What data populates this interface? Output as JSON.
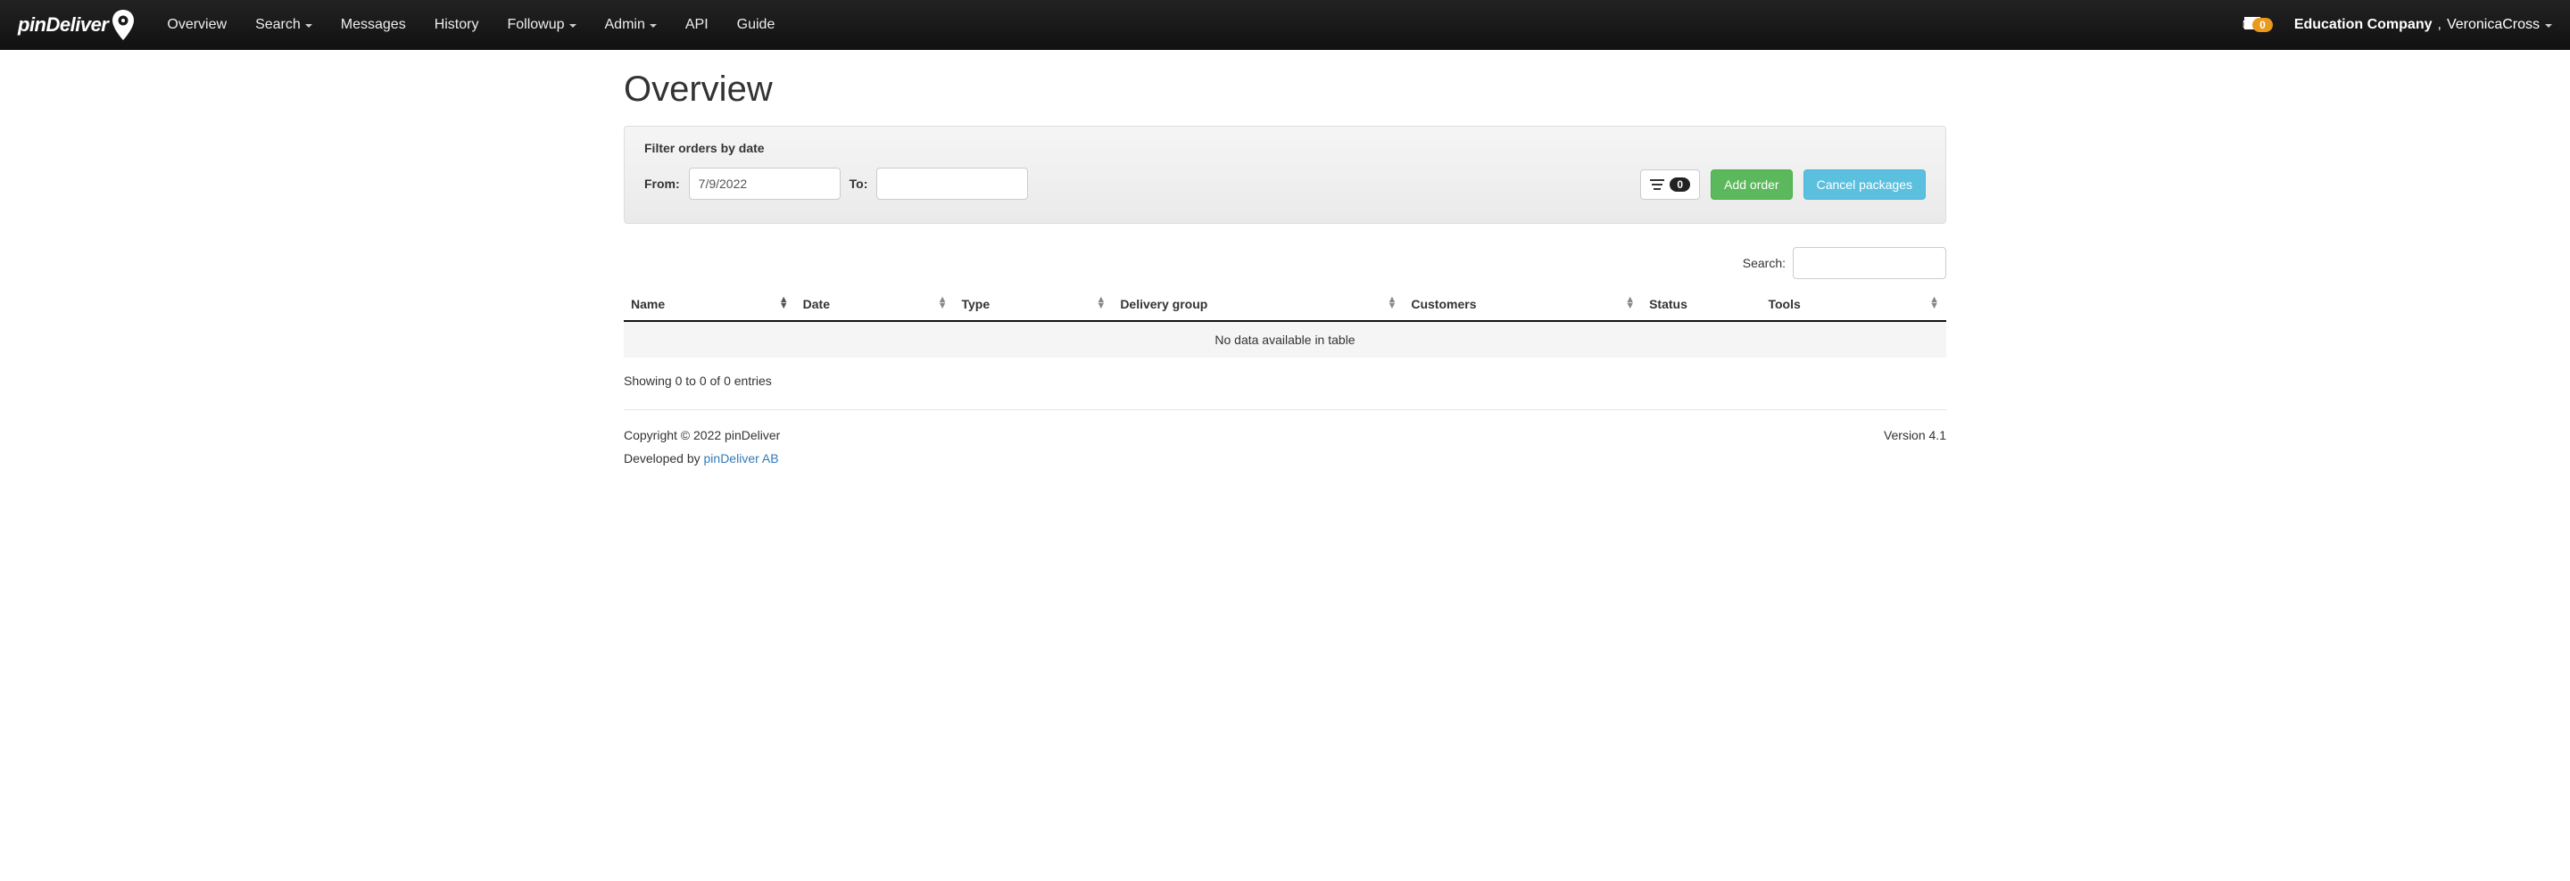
{
  "brand": "pinDeliver",
  "nav": {
    "items": [
      {
        "label": "Overview",
        "dropdown": false
      },
      {
        "label": "Search",
        "dropdown": true
      },
      {
        "label": "Messages",
        "dropdown": false
      },
      {
        "label": "History",
        "dropdown": false
      },
      {
        "label": "Followup",
        "dropdown": true
      },
      {
        "label": "Admin",
        "dropdown": true
      },
      {
        "label": "API",
        "dropdown": false
      },
      {
        "label": "Guide",
        "dropdown": false
      }
    ],
    "mail_count": "0",
    "company": "Education Company",
    "user": "VeronicaCross"
  },
  "page": {
    "title": "Overview",
    "filter_title": "Filter orders by date",
    "from_label": "From:",
    "from_value": "7/9/2022",
    "to_label": "To:",
    "to_value": "",
    "queue_count": "0",
    "add_order": "Add order",
    "cancel_packages": "Cancel packages"
  },
  "table": {
    "search_label": "Search:",
    "search_value": "",
    "columns": [
      "Name",
      "Date",
      "Type",
      "Delivery group",
      "Customers",
      "Status",
      "Tools"
    ],
    "empty_text": "No data available in table",
    "entries_info": "Showing 0 to 0 of 0 entries"
  },
  "footer": {
    "copyright": "Copyright © 2022 pinDeliver",
    "version": "Version 4.1",
    "developed_prefix": "Developed by ",
    "developed_link": "pinDeliver AB"
  }
}
